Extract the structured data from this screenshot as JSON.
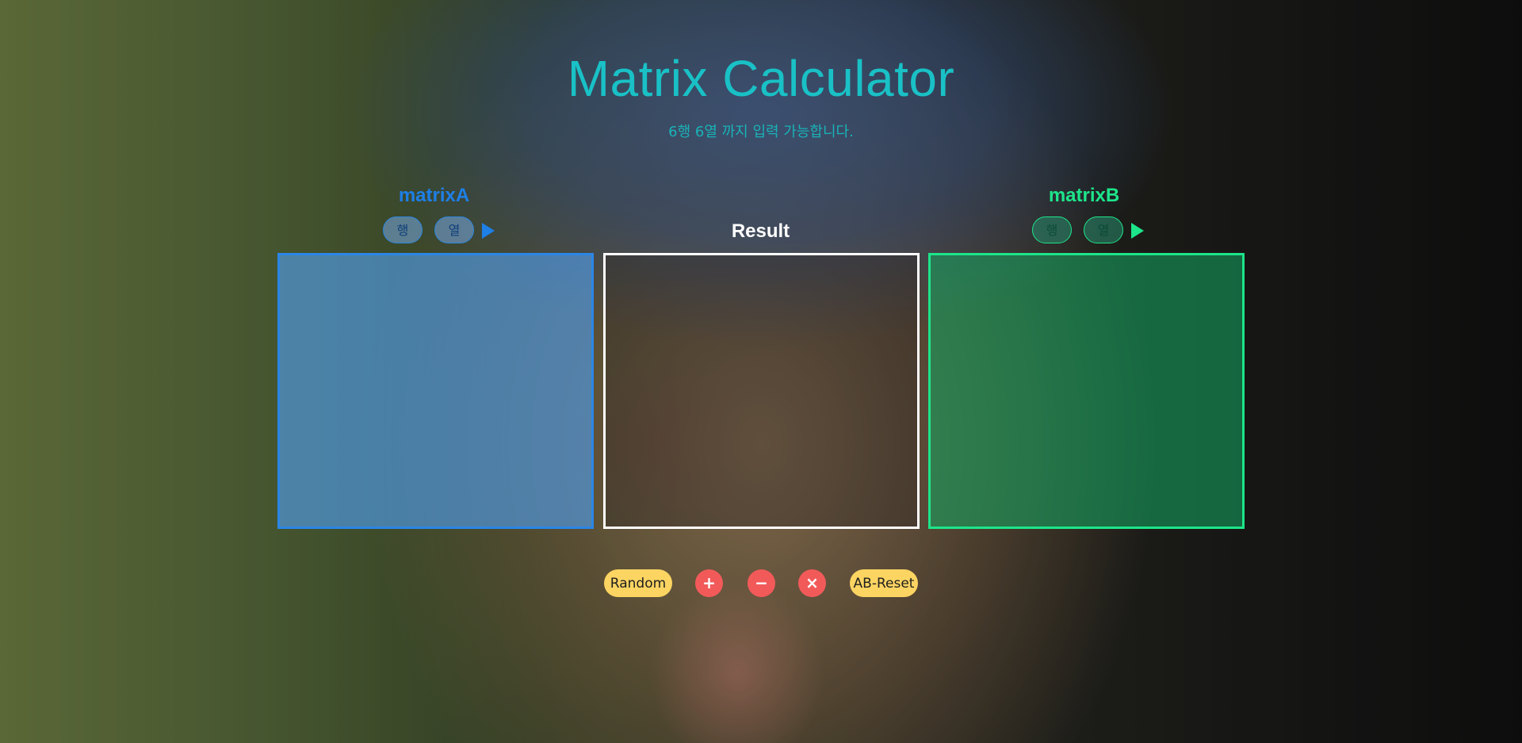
{
  "header": {
    "title": "Matrix Calculator",
    "subtitle": "6행 6열 까지 입력 가능합니다."
  },
  "matrixA": {
    "label": "matrixA",
    "row_placeholder": "행",
    "col_placeholder": "열",
    "accent_color": "#1e7fe6"
  },
  "matrixB": {
    "label": "matrixB",
    "row_placeholder": "행",
    "col_placeholder": "열",
    "accent_color": "#1de58a"
  },
  "result": {
    "label": "Result"
  },
  "controls": {
    "random_label": "Random",
    "add_label": "+",
    "subtract_label": "−",
    "multiply_label": "×",
    "reset_label": "AB-Reset"
  },
  "colors": {
    "title": "#19c1c6",
    "pill_button": "#fcd462",
    "round_button": "#f25a5a"
  },
  "icons": {
    "apply_a": "play-icon",
    "apply_b": "play-icon"
  }
}
